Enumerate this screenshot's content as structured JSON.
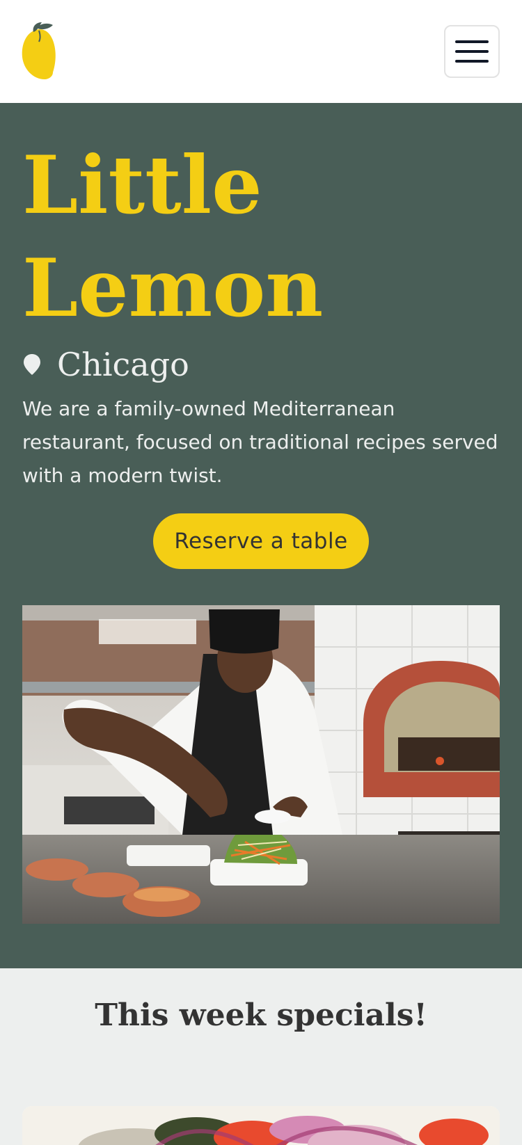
{
  "header": {
    "logo_icon": "lemon-icon",
    "menu_icon": "hamburger-menu-icon"
  },
  "hero": {
    "title_line1": "Little",
    "title_line2": "Lemon",
    "location_icon": "location-pin-icon",
    "location": "Chicago",
    "description": "We are a family-owned Mediterranean restaurant, focused on traditional recipes served with a modern twist.",
    "reserve_label": "Reserve a table"
  },
  "specials": {
    "title": "This week specials!"
  },
  "colors": {
    "primary_green": "#495e57",
    "primary_yellow": "#f4ce14",
    "light_gray": "#edefee",
    "dark_text": "#333333"
  }
}
